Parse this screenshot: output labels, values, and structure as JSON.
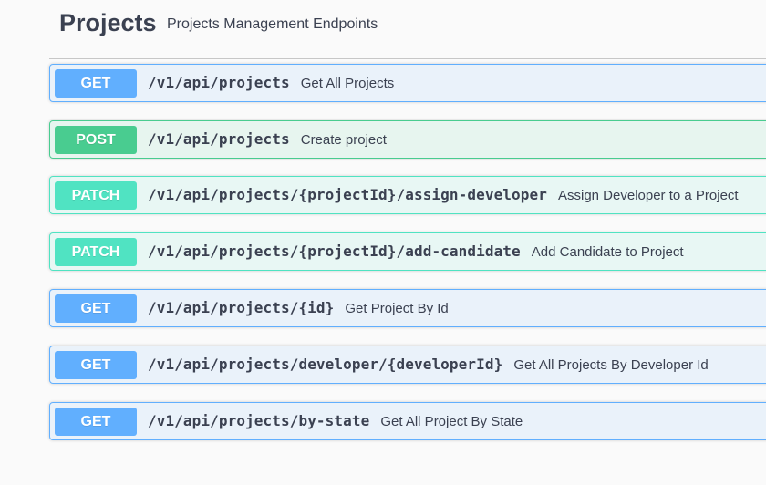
{
  "section": {
    "title": "Projects",
    "description": "Projects Management Endpoints"
  },
  "operations": [
    {
      "method": "GET",
      "path": "/v1/api/projects",
      "summary": "Get All Projects"
    },
    {
      "method": "POST",
      "path": "/v1/api/projects",
      "summary": "Create project"
    },
    {
      "method": "PATCH",
      "path": "/v1/api/projects/{projectId}/assign-developer",
      "summary": "Assign Developer to a Project"
    },
    {
      "method": "PATCH",
      "path": "/v1/api/projects/{projectId}/add-candidate",
      "summary": "Add Candidate to Project"
    },
    {
      "method": "GET",
      "path": "/v1/api/projects/{id}",
      "summary": "Get Project By Id"
    },
    {
      "method": "GET",
      "path": "/v1/api/projects/developer/{developerId}",
      "summary": "Get All Projects By Developer Id"
    },
    {
      "method": "GET",
      "path": "/v1/api/projects/by-state",
      "summary": "Get All Project By State"
    }
  ],
  "colors": {
    "get": "#61affe",
    "post": "#49cc90",
    "patch": "#50e3c2",
    "text": "#3b4151"
  }
}
